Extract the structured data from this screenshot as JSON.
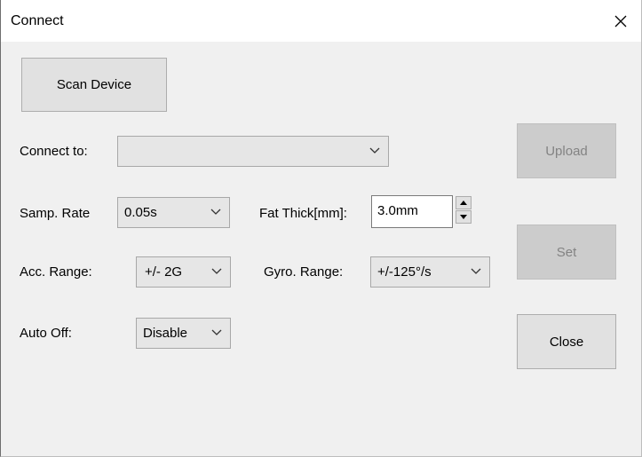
{
  "window": {
    "title": "Connect"
  },
  "buttons": {
    "scan": "Scan Device",
    "upload": "Upload",
    "set": "Set",
    "close": "Close"
  },
  "connect_to": {
    "label": "Connect to:",
    "value": ""
  },
  "samp_rate": {
    "label": "Samp. Rate",
    "value": "0.05s"
  },
  "fat_thick": {
    "label": "Fat Thick[mm]:",
    "value": "3.0mm"
  },
  "acc_range": {
    "label": "Acc. Range:",
    "value": "+/- 2G"
  },
  "gyro_range": {
    "label": "Gyro. Range:",
    "value": "+/-125°/s"
  },
  "auto_off": {
    "label": "Auto Off:",
    "value": "Disable"
  },
  "icons": {
    "close": "close-icon",
    "dropdown": "chevron-down-icon",
    "spin_up": "triangle-up-icon",
    "spin_down": "triangle-down-icon"
  }
}
